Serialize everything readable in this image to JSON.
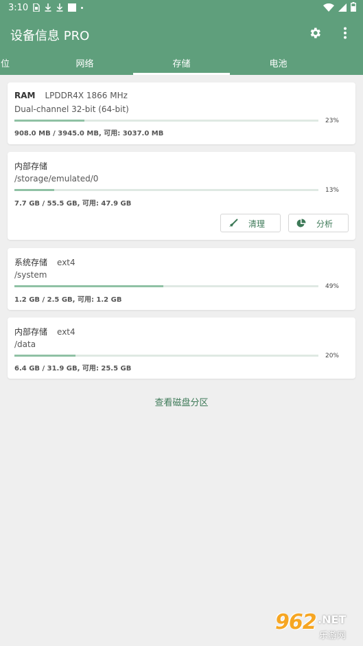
{
  "status_bar": {
    "time": "3:10"
  },
  "app_bar": {
    "title": "设备信息 PRO"
  },
  "tabs": [
    {
      "label": "位"
    },
    {
      "label": "网络"
    },
    {
      "label": "存储"
    },
    {
      "label": "电池"
    }
  ],
  "selected_tab": "存储",
  "cards": {
    "ram": {
      "title": "RAM",
      "subtitle": "LPDDR4X 1866 MHz",
      "line2": "Dual-channel 32-bit (64-bit)",
      "percent_label": "23%",
      "fraction": 0.23,
      "stats": "908.0 MB / 3945.0 MB, 可用: 3037.0 MB"
    },
    "internal": {
      "title": "内部存储",
      "line2": "/storage/emulated/0",
      "percent_label": "13%",
      "fraction": 0.13,
      "stats": "7.7 GB / 55.5 GB, 可用: 47.9 GB",
      "clean_label": "清理",
      "analyze_label": "分析"
    },
    "system": {
      "title": "系统存储",
      "subtitle": "ext4",
      "line2": "/system",
      "percent_label": "49%",
      "fraction": 0.49,
      "stats": "1.2 GB / 2.5 GB, 可用: 1.2 GB"
    },
    "data": {
      "title": "内部存储",
      "subtitle": "ext4",
      "line2": "/data",
      "percent_label": "20%",
      "fraction": 0.2,
      "stats": "6.4 GB / 31.9 GB, 可用: 25.5 GB"
    }
  },
  "partition_link": "查看磁盘分区",
  "watermark": {
    "number": "962",
    "suffix": ".NET",
    "site": "乐游网"
  },
  "colors": {
    "primary": "#5f9f7c",
    "accent_text": "#3e7a58",
    "bar_fill": "#8fc1a4",
    "bar_track": "#dfe9e3",
    "background": "#efefef"
  },
  "icons": {
    "status_left": [
      "sim-icon",
      "download-icon",
      "download-icon",
      "square-notification-icon",
      "dot-icon"
    ],
    "status_right": [
      "wifi-icon",
      "signal-icon",
      "battery-icon"
    ],
    "app_actions": [
      "gear-icon",
      "more-vert-icon"
    ],
    "clean": "broom-icon",
    "analyze": "pie-chart-icon"
  }
}
